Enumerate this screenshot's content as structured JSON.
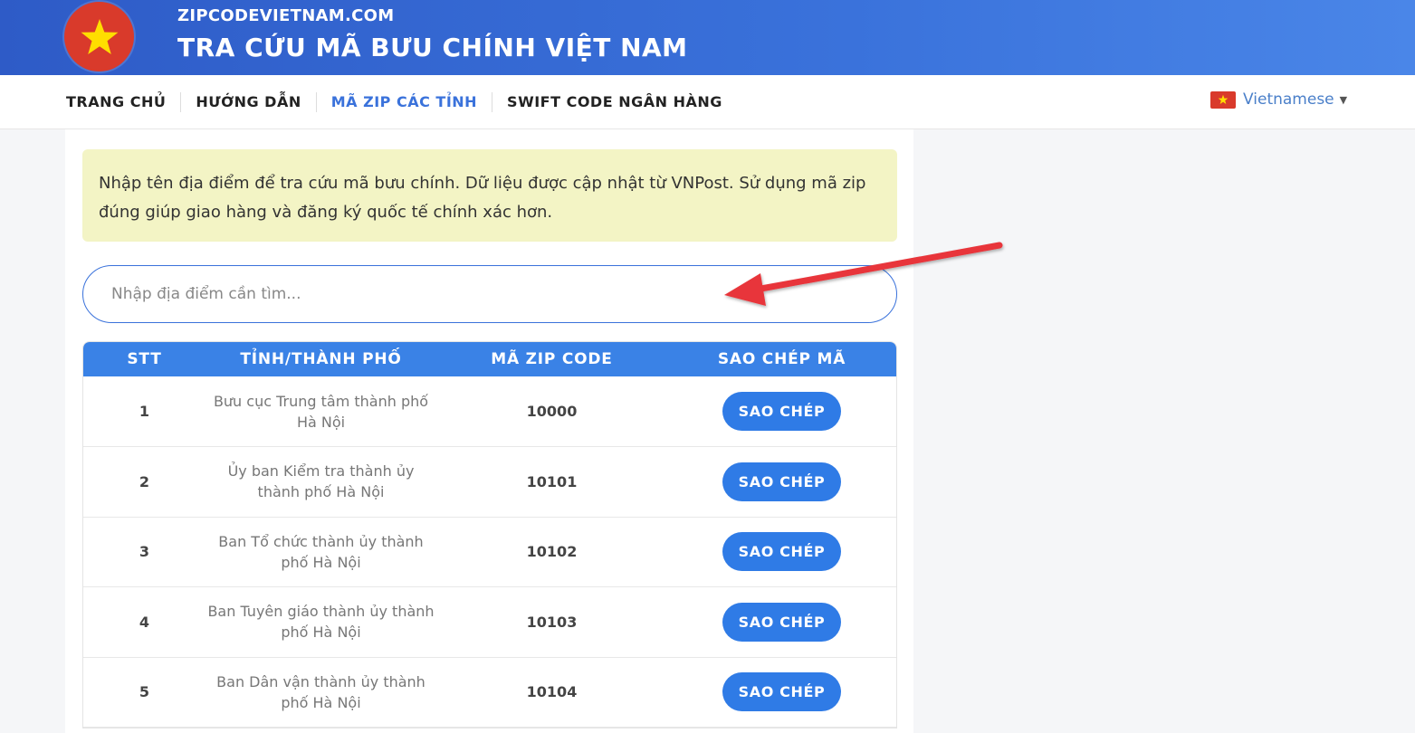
{
  "header": {
    "domain": "ZIPCODEVIETNAM.COM",
    "title": "TRA CỨU MÃ BƯU CHÍNH VIỆT NAM"
  },
  "nav": {
    "items": [
      {
        "label": "TRANG CHỦ"
      },
      {
        "label": "HƯỚNG DẪN"
      },
      {
        "label": "MÃ ZIP CÁC TỈNH"
      },
      {
        "label": "SWIFT CODE NGÂN HÀNG"
      }
    ],
    "active_index": 2
  },
  "language": {
    "label": "Vietnamese",
    "caret": "▼"
  },
  "notice": {
    "text": "Nhập tên địa điểm để tra cứu mã bưu chính. Dữ liệu được cập nhật từ VNPost. Sử dụng mã zip đúng giúp giao hàng và đăng ký quốc tế chính xác hơn."
  },
  "search": {
    "placeholder": "Nhập địa điểm cần tìm...",
    "value": ""
  },
  "table": {
    "headers": [
      "STT",
      "TỈNH/THÀNH PHỐ",
      "MÃ ZIP CODE",
      "SAO CHÉP MÃ"
    ],
    "rows": [
      {
        "stt": "1",
        "name": "Bưu cục Trung tâm thành phố Hà Nội",
        "zip": "10000",
        "button": "SAO CHÉP"
      },
      {
        "stt": "2",
        "name": "Ủy ban Kiểm tra thành ủy thành phố Hà Nội",
        "zip": "10101",
        "button": "SAO CHÉP"
      },
      {
        "stt": "3",
        "name": "Ban Tổ chức thành ủy thành phố Hà Nội",
        "zip": "10102",
        "button": "SAO CHÉP"
      },
      {
        "stt": "4",
        "name": "Ban Tuyên giáo thành ủy thành phố Hà Nội",
        "zip": "10103",
        "button": "SAO CHÉP"
      },
      {
        "stt": "5",
        "name": "Ban Dân vận thành ủy thành phố Hà Nội",
        "zip": "10104",
        "button": "SAO CHÉP"
      }
    ]
  },
  "colors": {
    "header_blue": "#3a72db",
    "button_blue": "#2f7be6",
    "flag_red": "#d93a2b",
    "star_yellow": "#ffde00",
    "notice_bg": "#f3f4c5",
    "annotation_arrow": "#e8353a"
  }
}
